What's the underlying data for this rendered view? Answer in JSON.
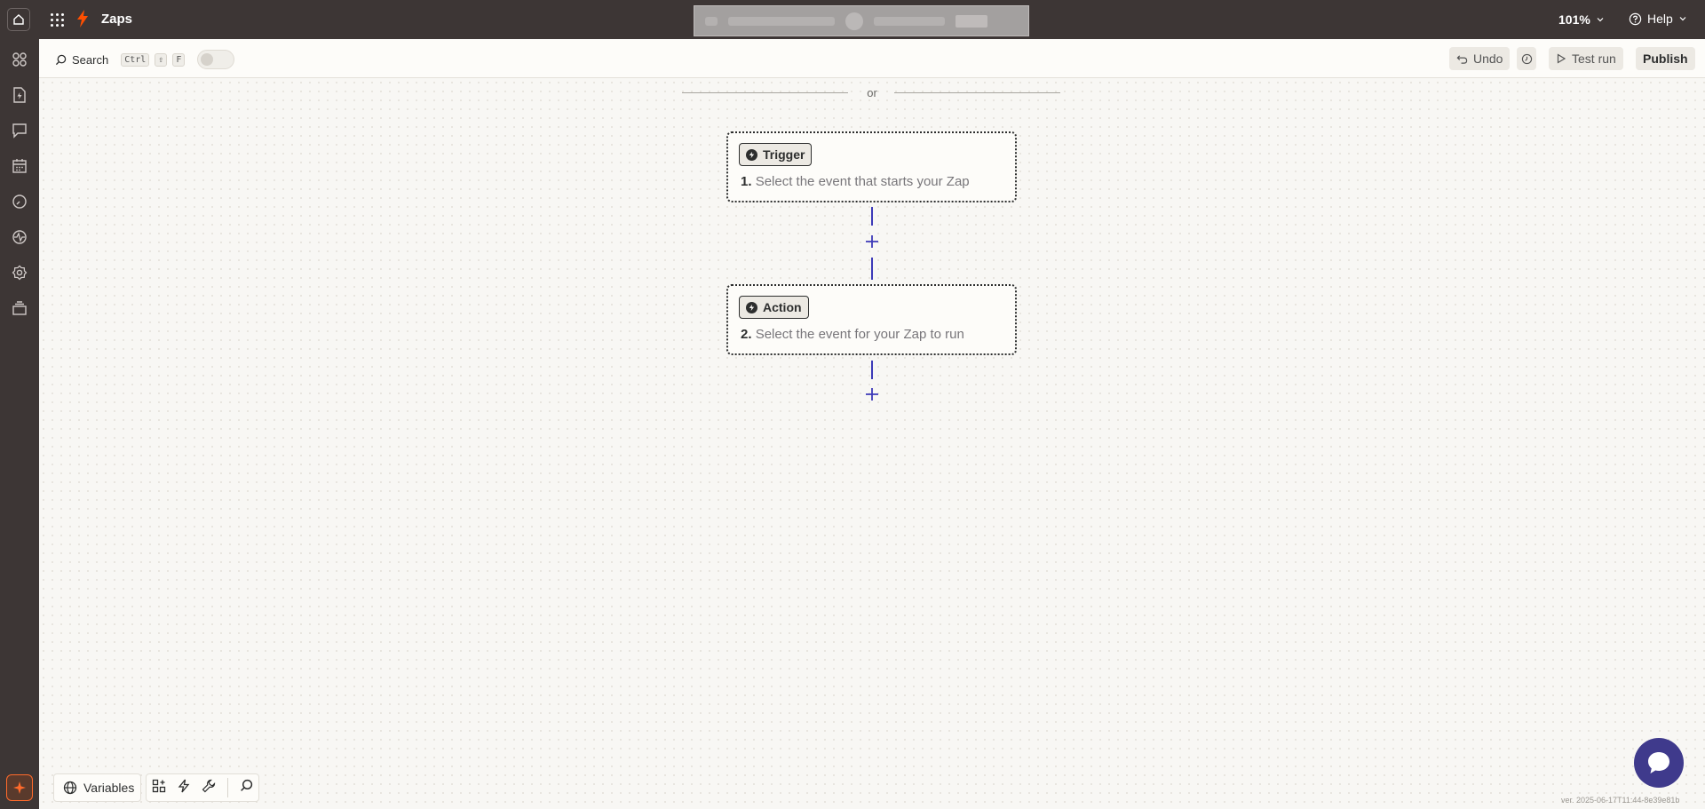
{
  "header": {
    "app_title": "Zaps",
    "zoom": "101%",
    "help_label": "Help"
  },
  "toolbar": {
    "search_label": "Search",
    "shortcut": [
      "Ctrl",
      "⇧",
      "F"
    ],
    "undo_label": "Undo",
    "test_run_label": "Test run",
    "publish_label": "Publish"
  },
  "canvas": {
    "or_label": "or",
    "trigger": {
      "pill_label": "Trigger",
      "number": "1.",
      "description": "Select the event that starts your Zap"
    },
    "action": {
      "pill_label": "Action",
      "number": "2.",
      "description": "Select the event for your Zap to run"
    }
  },
  "bottom": {
    "variables_label": "Variables",
    "version": "ver. 2025-06-17T11:44-8e39e81b"
  },
  "icons": {
    "left_rail": [
      "apps-icon",
      "zap-file-icon",
      "chat-icon",
      "calendar-icon",
      "history-icon",
      "activity-icon",
      "settings-icon",
      "layers-icon"
    ]
  },
  "colors": {
    "topbar": "#3d3635",
    "accent": "#ff4f00",
    "connector": "#3d3ab8",
    "chat": "#3f3a8c"
  }
}
